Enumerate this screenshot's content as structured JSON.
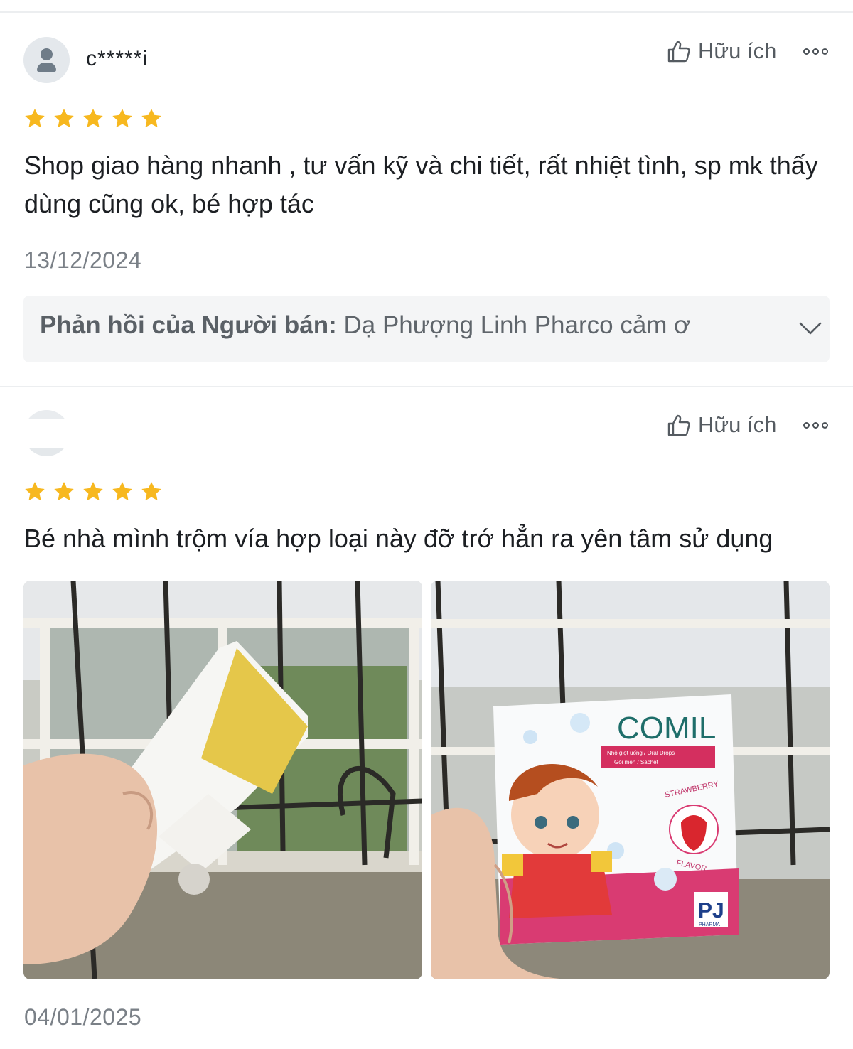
{
  "reviews": [
    {
      "username": "c*****i",
      "helpful_label": "Hữu ích",
      "rating": 5,
      "content": "Shop giao hàng nhanh , tư vấn kỹ và chi tiết, rất nhiệt tình, sp mk thấy dùng cũng ok, bé hợp tác",
      "date": "13/12/2024",
      "seller_reply": {
        "label": "Phản hồi của Người bán:",
        "text": "Dạ Phượng Linh Pharco cảm ơ"
      }
    },
    {
      "username": "",
      "helpful_label": "Hữu ích",
      "rating": 5,
      "content": "Bé nhà mình trộm vía hợp loại này đỡ trớ hẳn ra yên tâm sử dụng",
      "date": "04/01/2025",
      "photos": [
        {
          "description_icon": "open-box-photo"
        },
        {
          "description_icon": "product-box-photo",
          "brand": "COMIL",
          "subtitle1": "Nhỏ giọt uống / Oral Drops",
          "subtitle2": "Gói men / Sachet",
          "flavor_top": "STRAWBERRY",
          "flavor_bottom": "FLAVOR",
          "maker": "PJ",
          "maker_sub": "PHARMA"
        }
      ]
    }
  ],
  "colors": {
    "star": "#f7b81f",
    "divider": "#eceef0",
    "reply_bg": "#f4f5f6"
  }
}
